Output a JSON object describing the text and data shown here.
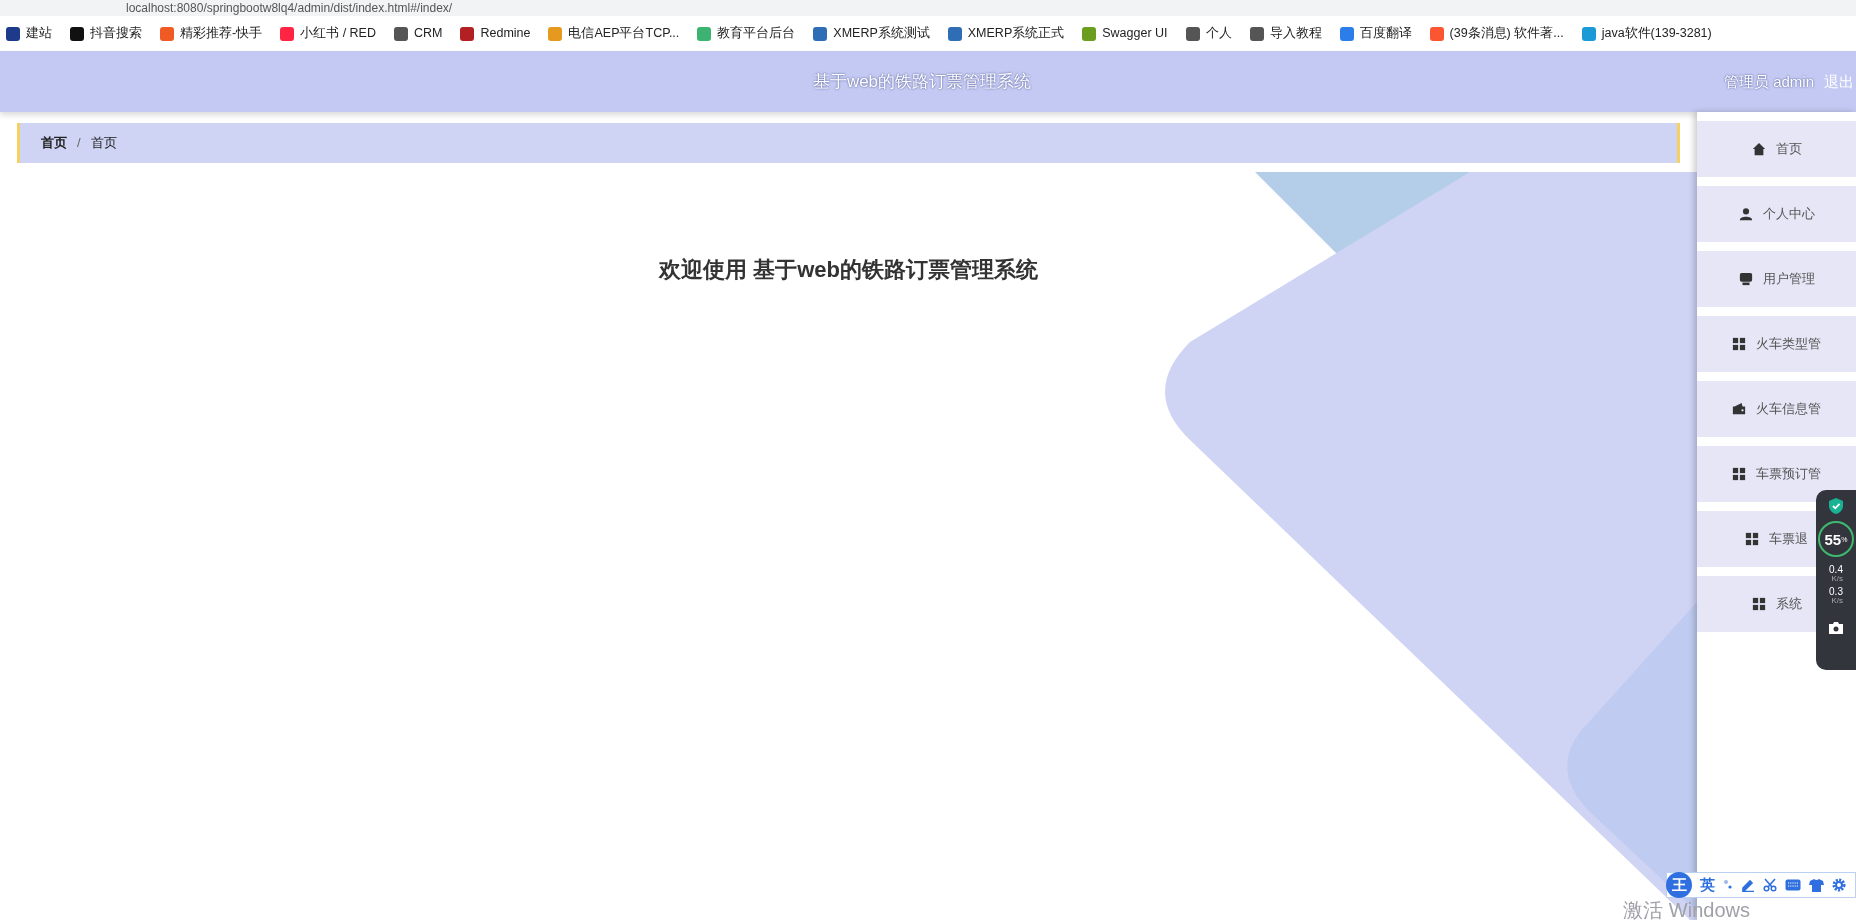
{
  "browser": {
    "url": "localhost:8080/springbootw8lq4/admin/dist/index.html#/index/",
    "bookmarks": [
      {
        "label": "建站",
        "color": "#1e3a8a"
      },
      {
        "label": "抖音搜索",
        "color": "#111111"
      },
      {
        "label": "精彩推荐-快手",
        "color": "#f05a23"
      },
      {
        "label": "小红书 / RED",
        "color": "#ff2442"
      },
      {
        "label": "CRM",
        "color": "#555555"
      },
      {
        "label": "Redmine",
        "color": "#b32024"
      },
      {
        "label": "电信AEP平台TCP...",
        "color": "#e59a1f"
      },
      {
        "label": "教育平台后台",
        "color": "#3cb371"
      },
      {
        "label": "XMERP系统测试",
        "color": "#2f6db5"
      },
      {
        "label": "XMERP系统正式",
        "color": "#2f6db5"
      },
      {
        "label": "Swagger UI",
        "color": "#6b9e1f"
      },
      {
        "label": "个人",
        "color": "#555555"
      },
      {
        "label": "导入教程",
        "color": "#555555"
      },
      {
        "label": "百度翻译",
        "color": "#2b7de9"
      },
      {
        "label": "(39条消息) 软件著...",
        "color": "#fc5531"
      },
      {
        "label": "java软件(139-3281)",
        "color": "#1a9bd8"
      }
    ]
  },
  "header": {
    "title": "基于web的铁路订票管理系统",
    "user": "管理员 admin",
    "logout": "退出"
  },
  "breadcrumb": {
    "items": [
      "首页",
      "首页"
    ],
    "separator": "/"
  },
  "welcome": "欢迎使用 基于web的铁路订票管理系统",
  "sidebar": {
    "items": [
      {
        "label": "首页",
        "kind": "home"
      },
      {
        "label": "个人中心",
        "kind": "user"
      },
      {
        "label": "用户管理",
        "kind": "desk"
      },
      {
        "label": "火车类型管",
        "kind": "grid"
      },
      {
        "label": "火车信息管",
        "kind": "wallet"
      },
      {
        "label": "车票预订管",
        "kind": "grid"
      },
      {
        "label": "车票退",
        "kind": "grid"
      },
      {
        "label": "系统",
        "kind": "grid"
      }
    ]
  },
  "monitor": {
    "percent": "55",
    "unit": "%",
    "up": "0.4",
    "up_unit": "K/s",
    "down": "0.3",
    "down_unit": "K/s"
  },
  "ime": {
    "badge": "王",
    "mode": "英"
  },
  "os_notice": "激活 Windows"
}
